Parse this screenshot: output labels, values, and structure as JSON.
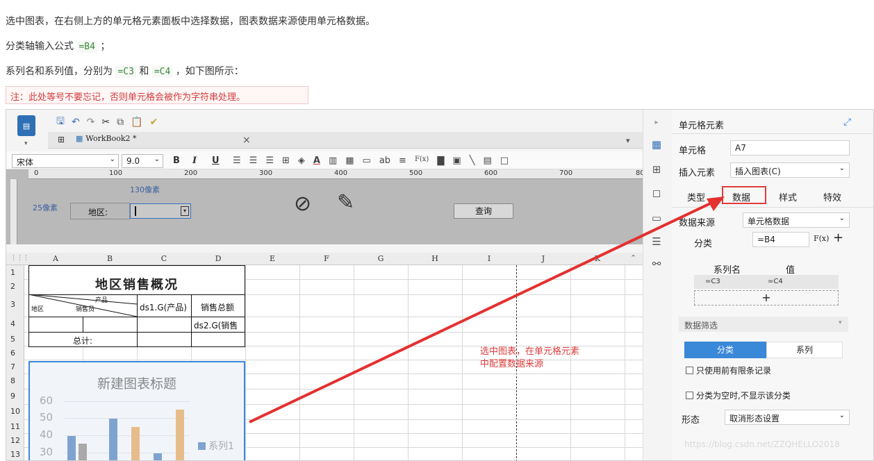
{
  "intro": {
    "line1": "选中图表，在右侧上方的单元格元素面板中选择数据，图表数据来源使用单元格数据。",
    "line2_prefix": "分类轴输入公式",
    "line2_code": "=B4",
    "line2_suffix": "；",
    "line3_prefix": "系列名和系列值，分别为",
    "line3_code1": "=C3",
    "line3_mid": "和",
    "line3_code2": "=C4",
    "line3_suffix": "，如下图所示：",
    "note": "注：此处等号不要忘记，否则单元格会被作为字符串处理。"
  },
  "toolbar": {
    "tab_label": "WorkBook2 *",
    "tab_close": "×",
    "font_name": "宋体",
    "font_size": "9.0",
    "bold": "B",
    "italic": "I",
    "underline": "U",
    "text_ab": "ab",
    "formula_icon": "F(x)"
  },
  "ruler": {
    "marks": [
      "0",
      "100",
      "200",
      "300",
      "400",
      "500",
      "600",
      "700",
      "80"
    ],
    "label_130": "130像素",
    "label_25": "25像素",
    "region_label": "地区:",
    "query_button": "查询"
  },
  "grid": {
    "columns": [
      "A",
      "B",
      "C",
      "D",
      "E",
      "F",
      "G",
      "H",
      "I",
      "J",
      "K"
    ],
    "rows": [
      "1",
      "2",
      "3",
      "4",
      "5",
      "6",
      "7",
      "8",
      "9",
      "10",
      "11",
      "12",
      "13"
    ],
    "title": "地区销售概况",
    "header_region": "地区",
    "header_product": "产品",
    "header_salesman": "销售员",
    "c3": "ds1.G(产品)",
    "d3": "销售总额",
    "d4": "ds2.G(销售",
    "b5": "总计:"
  },
  "chart": {
    "title": "新建图表标题",
    "y_ticks": [
      "60",
      "50",
      "40",
      "30"
    ],
    "legend": "系列1"
  },
  "annotation": {
    "text_line1": "选中图表，在单元格元素",
    "text_line2": "中配置数据来源"
  },
  "panel": {
    "title": "单元格元素",
    "cell_label": "单元格",
    "cell_value": "A7",
    "insert_label": "插入元素",
    "insert_value": "插入图表(C)",
    "tabs": [
      "类型",
      "数据",
      "样式",
      "特效"
    ],
    "source_label": "数据来源",
    "source_value": "单元格数据",
    "category_label": "分类",
    "category_value": "=B4",
    "fx": "F(x)",
    "plus": "+",
    "series_name_header": "系列名",
    "value_header": "值",
    "series_name": "=C3",
    "series_value": "=C4",
    "add": "+",
    "filter_title": "数据筛选",
    "filter_tabs": [
      "分类",
      "系列"
    ],
    "check1": "只使用前有限条记录",
    "check2": "分类为空时,不显示该分类",
    "shape_label": "形态",
    "shape_value": "取消形态设置"
  },
  "watermark": "https://blog.csdn.net/ZZQHELLO2018"
}
